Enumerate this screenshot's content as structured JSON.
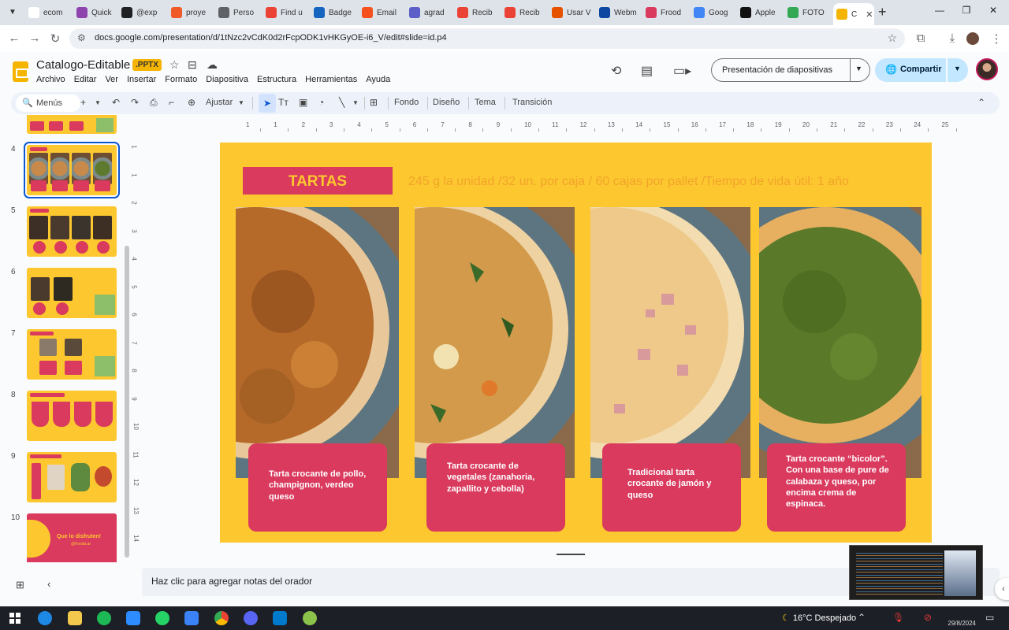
{
  "browser": {
    "tabs": [
      {
        "label": "ecom",
        "color": "#ffffff"
      },
      {
        "label": "Quick",
        "color": "#8e44ad"
      },
      {
        "label": "@exp",
        "color": "#202124"
      },
      {
        "label": "proye",
        "color": "#f05a28"
      },
      {
        "label": "Perso",
        "color": "#5f6368"
      },
      {
        "label": "Find u",
        "color": "#ea4335"
      },
      {
        "label": "Badge",
        "color": "#1565c0"
      },
      {
        "label": "Email",
        "color": "#f4511e"
      },
      {
        "label": "agrad",
        "color": "#5b5fc7"
      },
      {
        "label": "Recib",
        "color": "#ea4335"
      },
      {
        "label": "Recib",
        "color": "#ea4335"
      },
      {
        "label": "Usar V",
        "color": "#e65100"
      },
      {
        "label": "Webm",
        "color": "#0d47a1"
      },
      {
        "label": "Frood",
        "color": "#d93a5e"
      },
      {
        "label": "Goog",
        "color": "#4285f4"
      },
      {
        "label": "Apple",
        "color": "#111111"
      },
      {
        "label": "FOTO",
        "color": "#34a853"
      },
      {
        "label": "C",
        "color": "#f4b400"
      }
    ],
    "url": "docs.google.com/presentation/d/1tNzc2vCdK0d2rFcpODK1vHKGyOE-i6_V/edit#slide=id.p4"
  },
  "doc": {
    "title": "Catalogo-Editable",
    "badge": ".PPTX",
    "menu": [
      "Archivo",
      "Editar",
      "Ver",
      "Insertar",
      "Formato",
      "Diapositiva",
      "Estructura",
      "Herramientas",
      "Ayuda"
    ],
    "present_label": "Presentación de diapositivas",
    "share_label": "Compartir"
  },
  "toolbar": {
    "search_label": "Menús",
    "zoom_label": "Ajustar",
    "background": "Fondo",
    "layout": "Diseño",
    "theme": "Tema",
    "transition": "Transición"
  },
  "filmstrip": {
    "slides": [
      "4",
      "5",
      "6",
      "7",
      "8",
      "9",
      "10"
    ],
    "slide10_text": "Que lo disfruten!",
    "slide10_sub": "@frooda.ar"
  },
  "ruler": {
    "h": [
      "1",
      "1",
      "2",
      "3",
      "4",
      "5",
      "6",
      "7",
      "8",
      "9",
      "10",
      "11",
      "12",
      "13",
      "14",
      "15",
      "16",
      "17",
      "18",
      "19",
      "20",
      "21",
      "22",
      "23",
      "24",
      "25"
    ],
    "v": [
      "1",
      "1",
      "2",
      "3",
      "4",
      "5",
      "6",
      "7",
      "8",
      "9",
      "10",
      "11",
      "12",
      "13",
      "14"
    ]
  },
  "slide": {
    "heading": "TARTAS",
    "subtitle": "245 g la unidad /32 un. por caja / 60 cajas por pallet /Tiempo de vida útil: 1 año",
    "cards": [
      "Tarta crocante de pollo, champignon, verdeo queso",
      "Tarta crocante de vegetales (zanahoria, zapallito y cebolla)",
      "Tradicional tarta crocante de jamón y queso",
      "Tarta crocante “bicolor”. Con una base de pure de calabaza y queso, por encima crema de espinaca."
    ]
  },
  "notes": {
    "placeholder": "Haz clic para agregar notas del orador"
  },
  "taskbar": {
    "weather": "16°C Despejado",
    "date": "29/8/2024"
  },
  "colors": {
    "slide_bg": "#fdc82f",
    "accent_pink": "#d93a5e",
    "subtitle_orange": "#f2a32a"
  }
}
